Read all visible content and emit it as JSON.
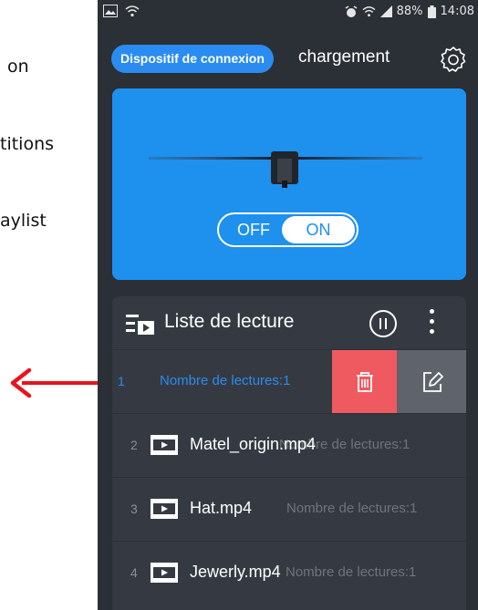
{
  "side_text": [
    "on",
    "titions",
    "aylist"
  ],
  "status_bar": {
    "battery": "88%",
    "time": "14:08"
  },
  "top_bar": {
    "connect_button": "Dispositif de connexion",
    "download_tab": "chargement",
    "settings_icon": "gear-icon"
  },
  "device_card": {
    "toggle_off_label": "OFF",
    "toggle_on_label": "ON",
    "toggle_state": "ON"
  },
  "playlist": {
    "title": "Liste de lecture",
    "items": [
      {
        "number": "1",
        "name": "",
        "plays": "Nombre de lectures:1"
      },
      {
        "number": "2",
        "name": "Matel_origin.mp4",
        "plays": "Nombre de lectures:1"
      },
      {
        "number": "3",
        "name": "Hat.mp4",
        "plays": "Nombre de lectures:1"
      },
      {
        "number": "4",
        "name": "Jewerly.mp4",
        "plays": "Nombre de lectures:1"
      }
    ],
    "swipe_actions": [
      "trash-icon",
      "edit-icon"
    ]
  },
  "colors": {
    "accent": "#2a8cf0",
    "card": "#1e90ee",
    "background": "#2b2f36",
    "delete": "#ef5a60",
    "edit": "#5f646c",
    "arrow": "#e8141c"
  }
}
